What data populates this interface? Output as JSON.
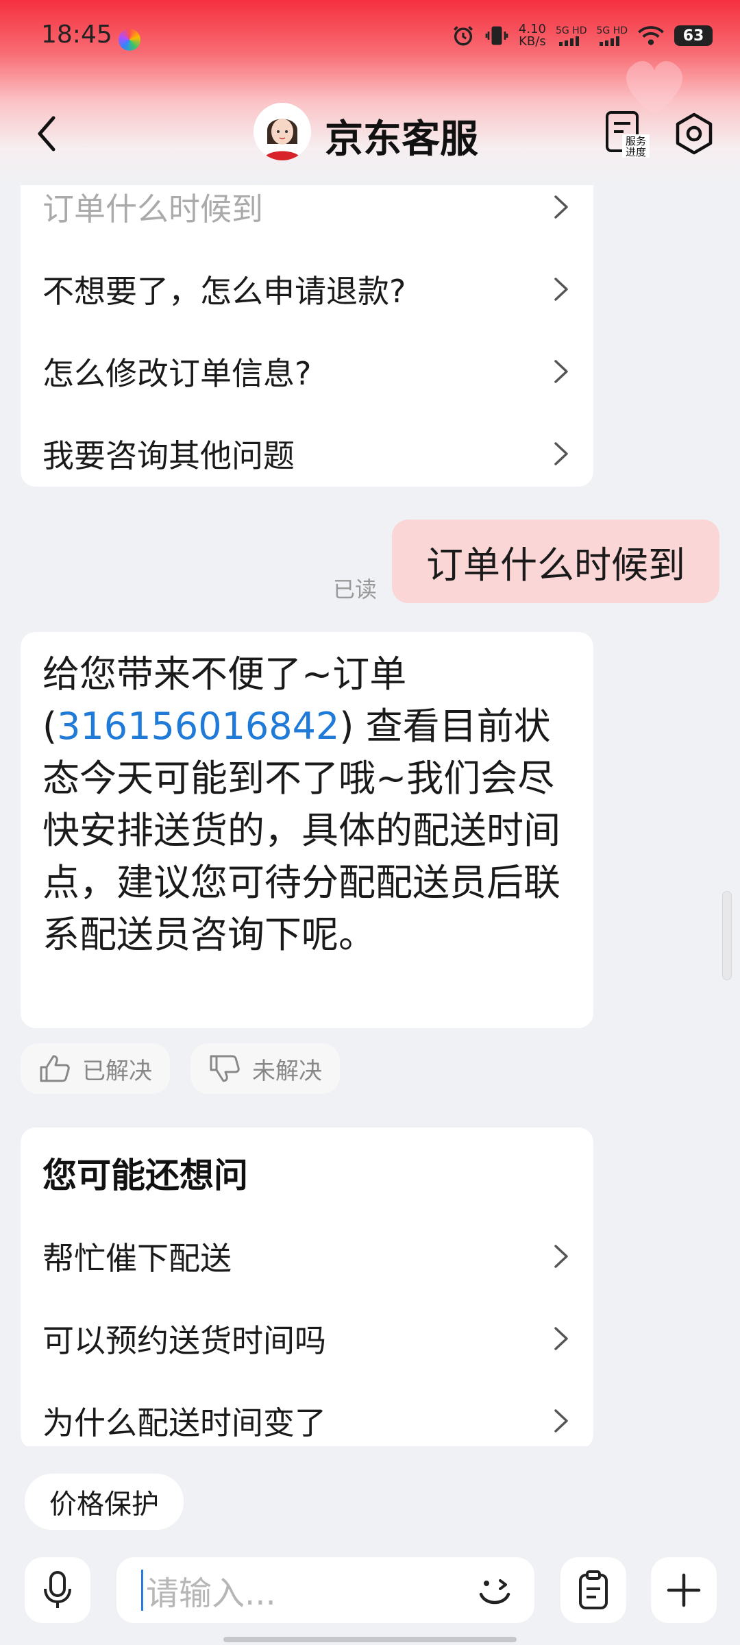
{
  "status_bar": {
    "time": "18:45",
    "net_speed_value": "4.10",
    "net_speed_unit": "KB/s",
    "sim1": "5G HD",
    "sim2": "5G HD",
    "battery": "63"
  },
  "header": {
    "title": "京东客服",
    "service_progress_label_1": "服务",
    "service_progress_label_2": "进度"
  },
  "top_questions": [
    {
      "label": "订单什么时候到"
    },
    {
      "label": "不想要了，怎么申请退款?"
    },
    {
      "label": "怎么修改订单信息?"
    },
    {
      "label": "我要咨询其他问题"
    }
  ],
  "user_message": {
    "text": "订单什么时候到",
    "read_status": "已读"
  },
  "reply": {
    "prefix": "给您带来不便了~订单(",
    "order_number": "316156016842",
    "suffix": ") 查看目前状态今天可能到不了哦~我们会尽快安排送货的，具体的配送时间点，建议您可待分配配送员后联系配送员咨询下呢。"
  },
  "feedback": {
    "resolved": "已解决",
    "unresolved": "未解决"
  },
  "suggestions": {
    "title": "您可能还想问",
    "items": [
      {
        "label": "帮忙催下配送"
      },
      {
        "label": "可以预约送货时间吗"
      },
      {
        "label": "为什么配送时间变了"
      }
    ]
  },
  "quick_chip": "价格保护",
  "input": {
    "placeholder": "请输入..."
  },
  "colors": {
    "accent_red": "#f5303f",
    "user_bubble": "#fbd6d6",
    "link_blue": "#1f7ad8"
  }
}
